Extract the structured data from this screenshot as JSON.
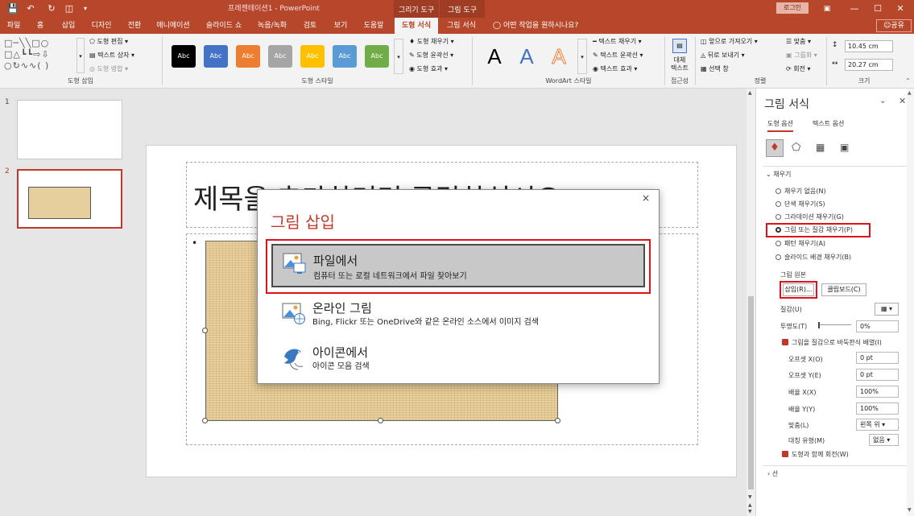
{
  "titlebar": {
    "title": "프레젠테이션1 - PowerPoint",
    "context_tab_drawing": "그리기 도구",
    "context_tab_picture": "그림 도구",
    "login": "로그인",
    "colors": {
      "accent": "#b7472a",
      "highlight": "#e0111a"
    }
  },
  "menu": {
    "items": [
      "파일",
      "홈",
      "삽입",
      "디자인",
      "전환",
      "애니메이션",
      "슬라이드 쇼",
      "녹음/녹화",
      "검토",
      "보기",
      "도움말"
    ],
    "active_tab": "도형 서식",
    "picture_format_tab": "그림 서식",
    "tell_me": "어떤 작업을 원하시나요?",
    "share": "공유"
  },
  "ribbon": {
    "insert_shapes": {
      "edit_shape": "도형 편집",
      "text_box": "텍스트 상자",
      "merge_shapes": "도형 병합",
      "label": "도형 삽입"
    },
    "shape_styles": {
      "tiles": [
        "Abc",
        "Abc",
        "Abc",
        "Abc",
        "Abc",
        "Abc",
        "Abc"
      ],
      "tile_colors": [
        "#000000",
        "#4472c4",
        "#ed7d31",
        "#a5a5a5",
        "#ffc000",
        "#5b9bd5",
        "#70ad47"
      ],
      "fill": "도형 채우기",
      "outline": "도형 윤곽선",
      "effects": "도형 효과",
      "label": "도형 스타일"
    },
    "wordart": {
      "letters": [
        "A",
        "A",
        "A"
      ],
      "text_fill": "텍스트 채우기",
      "text_outline": "텍스트 윤곽선",
      "text_effects": "텍스트 효과",
      "label": "WordArt 스타일"
    },
    "accessibility": {
      "alt_text_1": "대체",
      "alt_text_2": "텍스트",
      "label": "접근성"
    },
    "arrange": {
      "bring_forward": "앞으로 가져오기",
      "send_backward": "뒤로 보내기",
      "selection_pane": "선택 창",
      "align": "맞춤",
      "group": "그룹화",
      "rotate": "회전",
      "label": "정렬"
    },
    "size": {
      "height": "10.45 cm",
      "width": "20.27 cm",
      "label": "크기"
    }
  },
  "slides": {
    "numbers": [
      "1",
      "2"
    ]
  },
  "slide": {
    "title_text": "제목을 추가하려면 클릭하십시오"
  },
  "dialog": {
    "title": "그림 삽입",
    "close": "×",
    "items": [
      {
        "title": "파일에서",
        "desc": "컴퓨터 또는 로컬 네트워크에서 파일 찾아보기"
      },
      {
        "title": "온라인 그림",
        "desc": "Bing, Flickr 또는 OneDrive와 같은 온라인 소스에서 이미지 검색"
      },
      {
        "title": "아이콘에서",
        "desc": "아이콘 모음 검색"
      }
    ]
  },
  "format_pane": {
    "title": "그림 서식",
    "tab_shape_options": "도형 옵션",
    "tab_text_options": "텍스트 옵션",
    "fill_section": "채우기",
    "fill_options": [
      "채우기 없음(N)",
      "단색 채우기(S)",
      "그라데이션 채우기(G)",
      "그림 또는 질감 채우기(P)",
      "패턴 채우기(A)",
      "슬라이드 배경 채우기(B)"
    ],
    "selected_fill": 3,
    "picture_source": "그림 원본",
    "insert_btn": "삽입(R)...",
    "clipboard_btn": "클립보드(C)",
    "texture": "질감(U)",
    "transparency": "투명도(T)",
    "transparency_value": "0%",
    "tile_checkbox": "그림을 질감으로 바둑판식 배열(I)",
    "offset_x": "오프셋 X(O)",
    "offset_x_value": "0 pt",
    "offset_y": "오프셋 Y(E)",
    "offset_y_value": "0 pt",
    "scale_x": "배율 X(X)",
    "scale_x_value": "100%",
    "scale_y": "배율 Y(Y)",
    "scale_y_value": "100%",
    "alignment": "맞춤(L)",
    "alignment_value": "왼쪽 위",
    "mirror": "대칭 유형(M)",
    "mirror_value": "없음",
    "rotate_checkbox": "도형과 함께 회전(W)",
    "line_section": "선"
  }
}
